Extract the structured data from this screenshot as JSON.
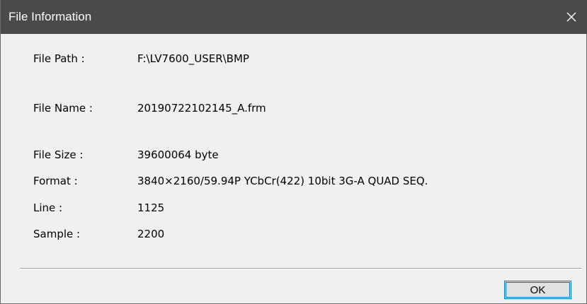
{
  "window": {
    "title": "File Information",
    "close_icon": "close-icon"
  },
  "fields": [
    {
      "label": "File Path :",
      "value": "F:\\LV7600_USER\\BMP"
    },
    {
      "label": "File Name :",
      "value": "20190722102145_A.frm"
    },
    {
      "label": "File Size :",
      "value": "39600064 byte"
    },
    {
      "label": "Format :",
      "value": "3840×2160/59.94P YCbCr(422) 10bit 3G-A QUAD SEQ."
    },
    {
      "label": "Line :",
      "value": "1125"
    },
    {
      "label": "Sample :",
      "value": "2200"
    }
  ],
  "buttons": {
    "ok_label": "OK"
  },
  "colors": {
    "titlebar": "#4a4a4a",
    "background": "#f0f0f0",
    "focus_border": "#0078d7"
  }
}
